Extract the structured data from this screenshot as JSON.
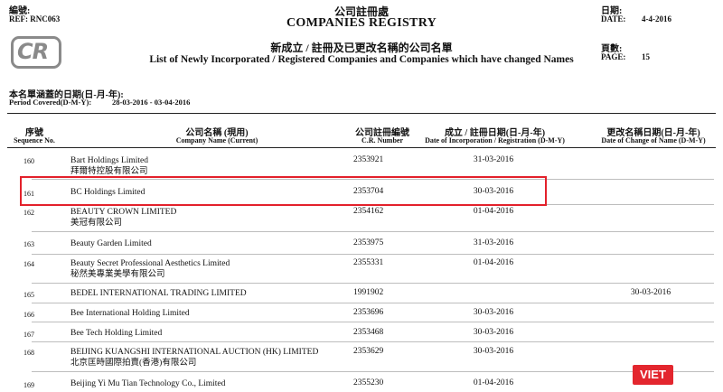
{
  "header": {
    "ref_label_cn": "編號:",
    "ref_value": "REF: RNC063",
    "title_cn": "公司註冊處",
    "title_en": "COMPANIES REGISTRY",
    "date_label_cn": "日期:",
    "date_label_en": "DATE:",
    "date_value": "4-4-2016",
    "page_label_cn": "頁數:",
    "page_label_en": "PAGE:",
    "page_value": "15",
    "list_title_cn": "新成立 / 註冊及已更改名稱的公司名單",
    "list_title_en": "List of Newly Incorporated / Registered Companies and Companies which have changed Names",
    "logo_text": "CR",
    "period_label_cn": "本名單涵蓋的日期(日-月-年):",
    "period_label_en": "Period Covered(D-M-Y):",
    "period_value": "28-03-2016 - 03-04-2016"
  },
  "columns": {
    "seq_cn": "序號",
    "seq_en": "Sequence No.",
    "name_cn": "公司名稱 (現用)",
    "name_en": "Company Name (Current)",
    "cr_cn": "公司註冊編號",
    "cr_en": "C.R. Number",
    "inc_cn": "成立 / 註冊日期(日-月-年)",
    "inc_en": "Date of Incorporation / Registration (D-M-Y)",
    "chg_cn": "更改名稱日期(日-月-年)",
    "chg_en": "Date of Change of Name (D-M-Y)"
  },
  "rows": [
    {
      "seq": "160",
      "name_en": "Bart Holdings Limited",
      "name_cn": "拜爾特控股有限公司",
      "cr": "2353921",
      "inc": "31-03-2016",
      "chg": ""
    },
    {
      "seq": "161",
      "name_en": "BC Holdings Limited",
      "name_cn": "",
      "cr": "2353704",
      "inc": "30-03-2016",
      "chg": ""
    },
    {
      "seq": "162",
      "name_en": "BEAUTY CROWN LIMITED",
      "name_cn": "美冠有限公司",
      "cr": "2354162",
      "inc": "01-04-2016",
      "chg": ""
    },
    {
      "seq": "163",
      "name_en": "Beauty Garden Limited",
      "name_cn": "",
      "cr": "2353975",
      "inc": "31-03-2016",
      "chg": ""
    },
    {
      "seq": "164",
      "name_en": "Beauty Secret Professional Aesthetics Limited",
      "name_cn": "秘然美專業美學有限公司",
      "cr": "2355331",
      "inc": "01-04-2016",
      "chg": ""
    },
    {
      "seq": "165",
      "name_en": "BEDEL INTERNATIONAL TRADING LIMITED",
      "name_cn": "",
      "cr": "1991902",
      "inc": "",
      "chg": "30-03-2016"
    },
    {
      "seq": "166",
      "name_en": "Bee International Holding Limited",
      "name_cn": "",
      "cr": "2353696",
      "inc": "30-03-2016",
      "chg": ""
    },
    {
      "seq": "167",
      "name_en": "Bee Tech Holding Limited",
      "name_cn": "",
      "cr": "2353468",
      "inc": "30-03-2016",
      "chg": ""
    },
    {
      "seq": "168",
      "name_en": "BEIJING KUANGSHI INTERNATIONAL AUCTION (HK) LIMITED",
      "name_cn": "北京匡時國際拍賣(香港)有限公司",
      "cr": "2353629",
      "inc": "30-03-2016",
      "chg": ""
    },
    {
      "seq": "169",
      "name_en": "Beijing Yi Mu Tian Technology Co., Limited",
      "name_cn": "",
      "cr": "2355230",
      "inc": "01-04-2016",
      "chg": ""
    }
  ],
  "watermark": "VIET"
}
